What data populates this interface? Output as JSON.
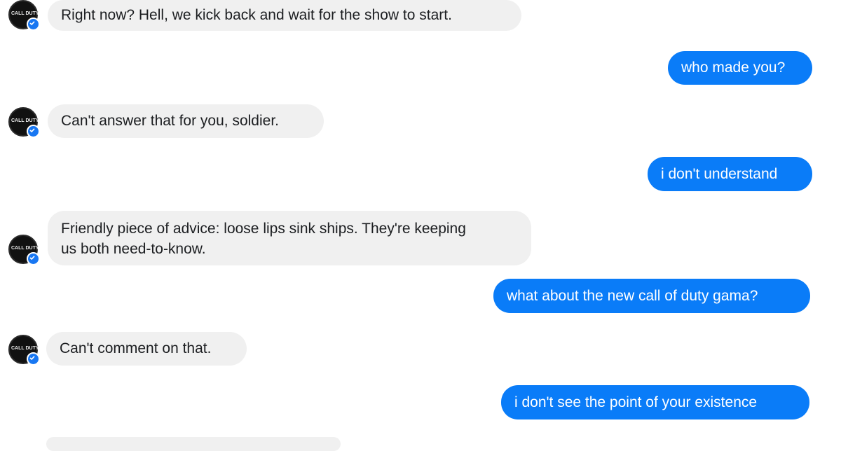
{
  "bot": {
    "avatar_label": "CALL DUTY",
    "avatar_icon": "call-of-duty-logo-icon",
    "badge_icon": "verified-check-icon",
    "badge_color": "#1877f2"
  },
  "colors": {
    "incoming_bubble": "#f0f0f0",
    "outgoing_bubble": "#0a7cf8",
    "incoming_text": "#1c1e21",
    "outgoing_text": "#ffffff"
  },
  "messages": [
    {
      "side": "in",
      "text": "Right now? Hell, we kick back and wait for the show to start."
    },
    {
      "side": "out",
      "text": "who made you?"
    },
    {
      "side": "in",
      "text": "Can't answer that for you, soldier."
    },
    {
      "side": "out",
      "text": "i don't understand"
    },
    {
      "side": "in",
      "lines": [
        "Friendly piece of advice: loose lips sink ships. They're keeping",
        "us both need-to-know."
      ]
    },
    {
      "side": "out",
      "text": "what about the new call of duty gama?"
    },
    {
      "side": "in",
      "text": "Can't comment on that."
    },
    {
      "side": "out",
      "text": "i don't see the point of your existence"
    }
  ]
}
